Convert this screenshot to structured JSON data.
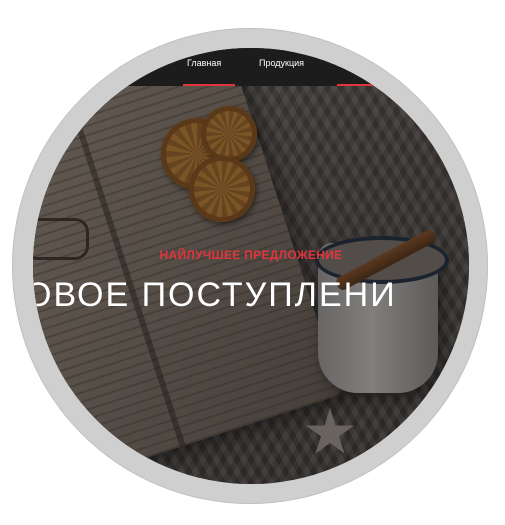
{
  "nav": {
    "items": [
      {
        "label": "Главная",
        "active": true
      },
      {
        "label": "Продукция",
        "active": false
      },
      {
        "label": "",
        "active": true
      }
    ]
  },
  "hero": {
    "subtitle": "НАЙЛУЧШЕЕ ПРЕДЛОЖЕНИЕ",
    "title": "ОВОЕ ПОСТУПЛЕНИ"
  },
  "colors": {
    "accent": "#e0353d",
    "navbar": "#1c1c1c",
    "frame": "#cfcfcf"
  }
}
